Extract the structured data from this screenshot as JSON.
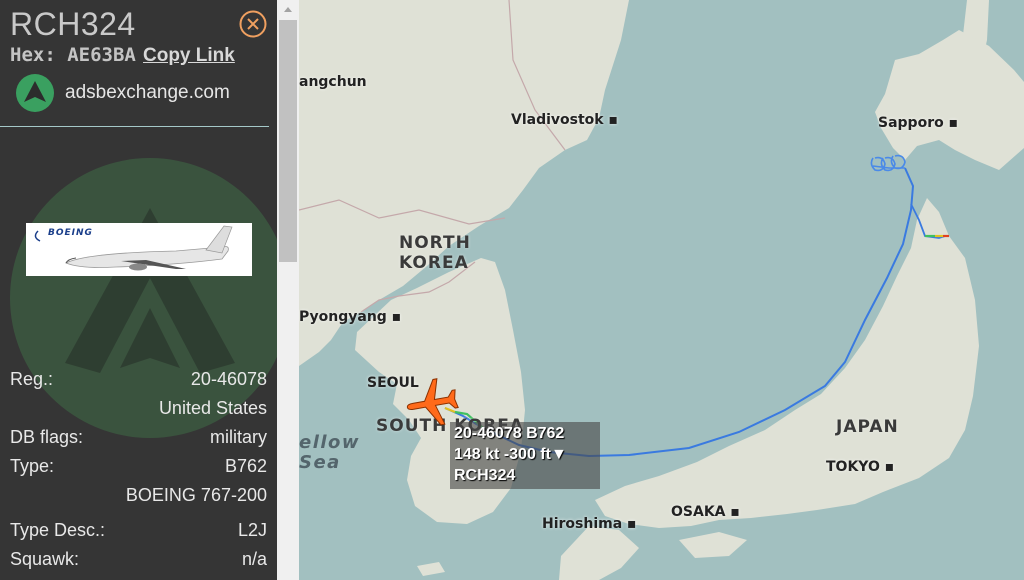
{
  "sidebar": {
    "callsign": "RCH324",
    "hex_label": "Hex:",
    "hex": "AE63BA",
    "copy_link_label": "Copy Link",
    "site_name": "adsbexchange.com",
    "photo_brand": "BOEING",
    "info_rows": [
      {
        "label": "Reg.:",
        "value": "20-46078"
      },
      {
        "label": "",
        "value": "United States"
      },
      {
        "label": "DB flags:",
        "value": "military"
      },
      {
        "label": "Type:",
        "value": "B762"
      },
      {
        "label": "",
        "value": "BOEING 767-200"
      },
      {
        "label": "Type Desc.:",
        "value": "L2J"
      },
      {
        "label": "Squawk:",
        "value": "n/a"
      }
    ]
  },
  "map": {
    "cities": [
      "angchun",
      "Vladivostok",
      "Sapporo",
      "Pyongyang",
      "SEOUL",
      "TOKYO",
      "OSAKA",
      "Hiroshima"
    ],
    "countries": {
      "north_korea_line1": "NORTH",
      "north_korea_line2": "KOREA",
      "south_korea": "SOUTH KOREA",
      "japan": "JAPAN"
    },
    "sea": {
      "line1": "ellow",
      "line2": "Sea"
    }
  },
  "tooltip": {
    "line1": "20-46078 B762",
    "line2": "148 kt  -300 ft▼",
    "line3": "RCH324"
  },
  "colors": {
    "sidebar_bg": "#353535",
    "sea": "#a2c0c0",
    "land": "#dfe1d6",
    "track": "#3a7ae0",
    "aircraft": "#ff6a1a",
    "accent_orange": "#f0a060"
  },
  "icons": {
    "close": "circle-x-icon",
    "site_logo": "adsbx-logo-icon",
    "aircraft": "airplane-icon"
  }
}
